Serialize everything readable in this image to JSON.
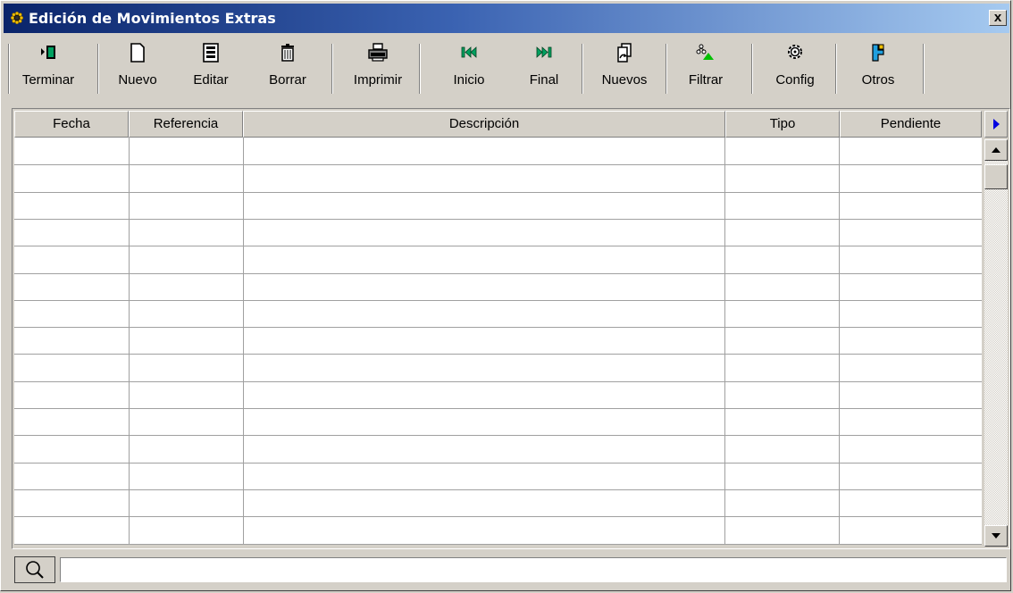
{
  "window": {
    "title": "Edición de Movimientos Extras",
    "close_label": "x"
  },
  "toolbar": {
    "items": [
      {
        "label": "Terminar",
        "icon": "exit-icon"
      },
      {
        "label": "Nuevo",
        "icon": "new-document-icon"
      },
      {
        "label": "Editar",
        "icon": "edit-form-icon"
      },
      {
        "label": "Borrar",
        "icon": "trash-icon"
      },
      {
        "label": "Imprimir",
        "icon": "printer-icon"
      },
      {
        "label": "Inicio",
        "icon": "first-record-icon"
      },
      {
        "label": "Final",
        "icon": "last-record-icon"
      },
      {
        "label": "Nuevos",
        "icon": "new-items-icon"
      },
      {
        "label": "Filtrar",
        "icon": "filter-icon"
      },
      {
        "label": "Config",
        "icon": "gear-icon"
      },
      {
        "label": "Otros",
        "icon": "others-icon"
      }
    ]
  },
  "grid": {
    "columns": [
      "Fecha",
      "Referencia",
      "Descripción",
      "Tipo",
      "Pendiente"
    ],
    "rows": []
  },
  "search": {
    "value": ""
  },
  "colors": {
    "title_gradient_start": "#0a246a",
    "title_gradient_end": "#a6caf0",
    "nav_green": "#00a060",
    "filter_green": "#00c000"
  }
}
